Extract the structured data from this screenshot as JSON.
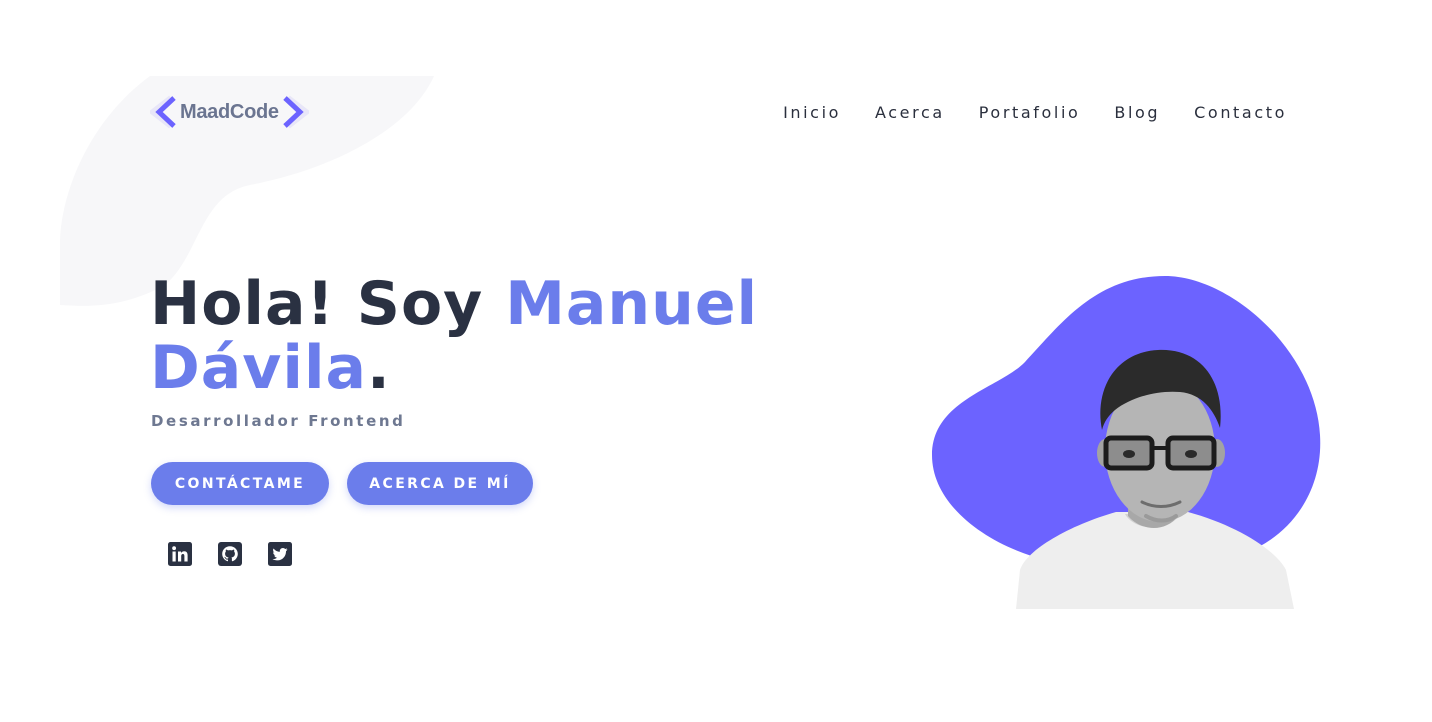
{
  "brand": {
    "logo_text": "MaadCode"
  },
  "nav": {
    "items": [
      "Inicio",
      "Acerca",
      "Portafolio",
      "Blog",
      "Contacto"
    ]
  },
  "hero": {
    "title_part1": "Hola! Soy ",
    "title_name": "Manuel Dávila",
    "title_period": ".",
    "subtitle": "Desarrollador Frontend"
  },
  "buttons": {
    "contact_label": "CONTÁCTAME",
    "about_label": "ACERCA DE MÍ"
  },
  "social": [
    {
      "icon": "linkedin-icon"
    },
    {
      "icon": "github-icon"
    },
    {
      "icon": "twitter-icon"
    }
  ],
  "colors": {
    "accent": "#6b7deb",
    "dark_text": "#2a3142",
    "muted_text": "#6e7891",
    "blob": "#6c63ff"
  }
}
